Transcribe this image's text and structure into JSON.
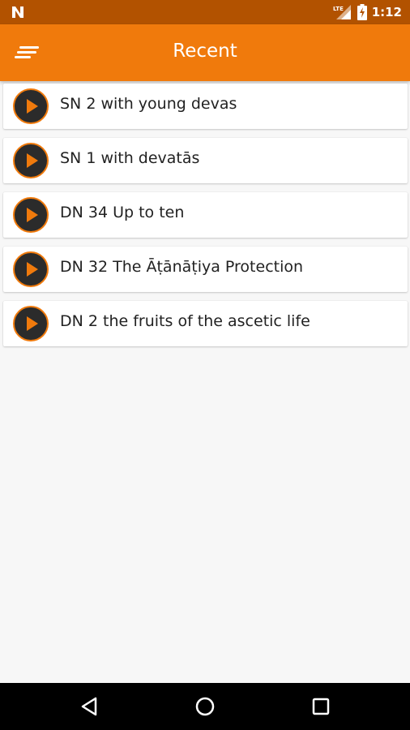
{
  "status": {
    "time": "1:12",
    "network": "LTE"
  },
  "appbar": {
    "title": "Recent"
  },
  "icons": {
    "status_app": "notification-n-icon",
    "signal": "lte-signal-icon",
    "battery": "battery-charging-icon",
    "menu": "menu-icon",
    "play": "play-icon",
    "nav_back": "back-triangle-icon",
    "nav_home": "home-circle-icon",
    "nav_recents": "recents-square-icon"
  },
  "colors": {
    "accent": "#f07a0c",
    "status_bar": "#b25200",
    "play_bg": "#2b2b2b"
  },
  "recent": {
    "items": [
      {
        "label": "SN 2 with young devas"
      },
      {
        "label": "SN 1 with devatās"
      },
      {
        "label": "DN 34 Up to ten"
      },
      {
        "label": "DN 32 The Āṭānāṭiya Protection"
      },
      {
        "label": "DN 2 the fruits of the ascetic life"
      }
    ]
  }
}
